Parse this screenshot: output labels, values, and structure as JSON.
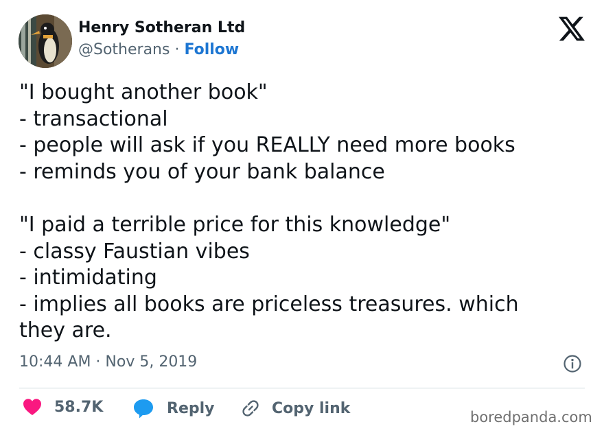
{
  "author": {
    "display_name": "Henry Sotheran Ltd",
    "handle": "@Sotherans",
    "separator": "·",
    "follow_label": "Follow",
    "avatar_icon": "penguin-avatar-icon"
  },
  "platform": {
    "logo_icon": "x-logo-icon"
  },
  "tweet": {
    "lines": [
      "\"I bought another book\"",
      "- transactional",
      "- people will ask if you REALLY need more books",
      "- reminds you of your bank balance",
      "",
      "\"I paid a terrible price for this knowledge\"",
      "- classy Faustian vibes",
      "- intimidating",
      "- implies all books are priceless treasures. which",
      "they are."
    ],
    "timestamp": "10:44 AM · Nov 5, 2019"
  },
  "actions": {
    "like_count": "58.7K",
    "reply_label": "Reply",
    "copy_link_label": "Copy link"
  },
  "watermark": "boredpanda.com",
  "colors": {
    "text": "#0f1419",
    "secondary": "#536471",
    "link": "#1d76d2",
    "like": "#f91880",
    "reply": "#1d9bf0",
    "divider": "#cfd9de"
  }
}
